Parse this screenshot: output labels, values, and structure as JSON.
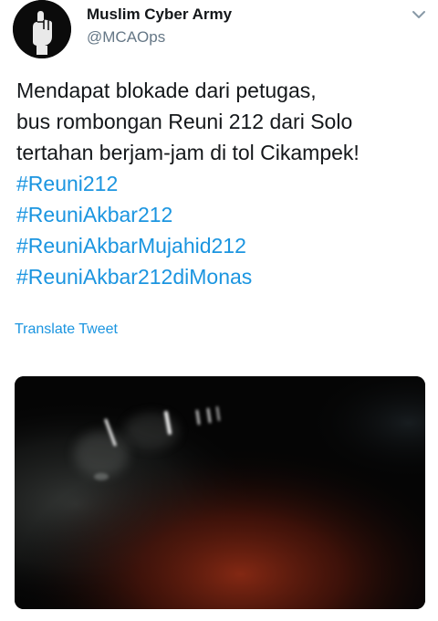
{
  "author": {
    "name": "Muslim Cyber Army",
    "handle": "@MCAOps",
    "avatar_icon": "raised-fist-avatar-icon"
  },
  "menu_icon": "chevron-down-icon",
  "tweet": {
    "text_lines": [
      "Mendapat blokade dari petugas,",
      "bus rombongan Reuni 212 dari Solo",
      "tertahan berjam-jam di tol Cikampek!"
    ],
    "hashtags": [
      "#Reuni212",
      "#ReuniAkbar212",
      "#ReuniAkbarMujahid212",
      "#ReuniAkbar212diMonas"
    ],
    "translate_label": "Translate Tweet"
  },
  "media": {
    "kind": "video-thumbnail"
  },
  "colors": {
    "text": "#14171a",
    "secondary": "#657786",
    "link": "#1b95e0"
  }
}
